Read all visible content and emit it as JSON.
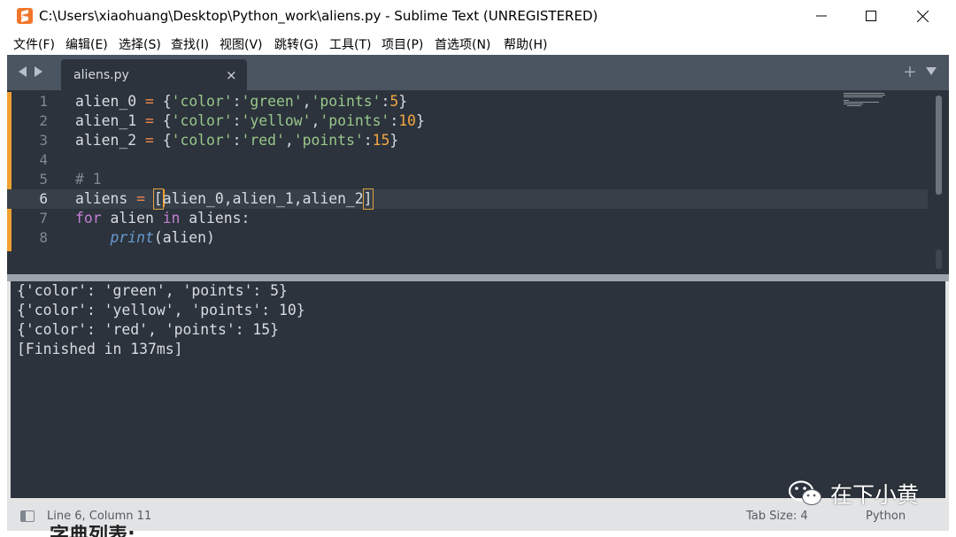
{
  "window": {
    "title": "C:\\Users\\xiaohuang\\Desktop\\Python_work\\aliens.py - Sublime Text (UNREGISTERED)",
    "minimize_icon": "minimize-icon",
    "maximize_icon": "maximize-icon",
    "close_icon": "close-icon"
  },
  "menu": [
    "文件(F)",
    "编辑(E)",
    "选择(S)",
    "查找(I)",
    "视图(V)",
    "跳转(G)",
    "工具(T)",
    "项目(P)",
    "首选项(N)",
    "帮助(H)"
  ],
  "tabs": [
    {
      "label": "aliens.py",
      "close": "×"
    }
  ],
  "tabbar": {
    "new_tab": "+"
  },
  "editor": {
    "line_numbers": [
      "1",
      "2",
      "3",
      "4",
      "5",
      "6",
      "7",
      "8"
    ],
    "current_line": 6,
    "code_lines": [
      "alien_0 = {'color':'green','points':5}",
      "alien_1 = {'color':'yellow','points':10}",
      "alien_2 = {'color':'red','points':15}",
      "",
      "# 1",
      "aliens = [alien_0,alien_1,alien_2]",
      "for alien in aliens:",
      "    print(alien)"
    ]
  },
  "output": [
    "{'color': 'green', 'points': 5}",
    "{'color': 'yellow', 'points': 10}",
    "{'color': 'red', 'points': 15}",
    "[Finished in 137ms]"
  ],
  "status": {
    "position": "Line 6, Column 11",
    "tab_size": "Tab Size: 4",
    "syntax": "Python"
  },
  "watermark": "在下小黄",
  "bottom_text": "字典列表:",
  "colors": {
    "editor_bg": "#2c333c",
    "keyword": "#c47fd5",
    "string": "#99c78a",
    "number": "#f5a742",
    "operator": "#f1884a",
    "function": "#6699cc"
  }
}
